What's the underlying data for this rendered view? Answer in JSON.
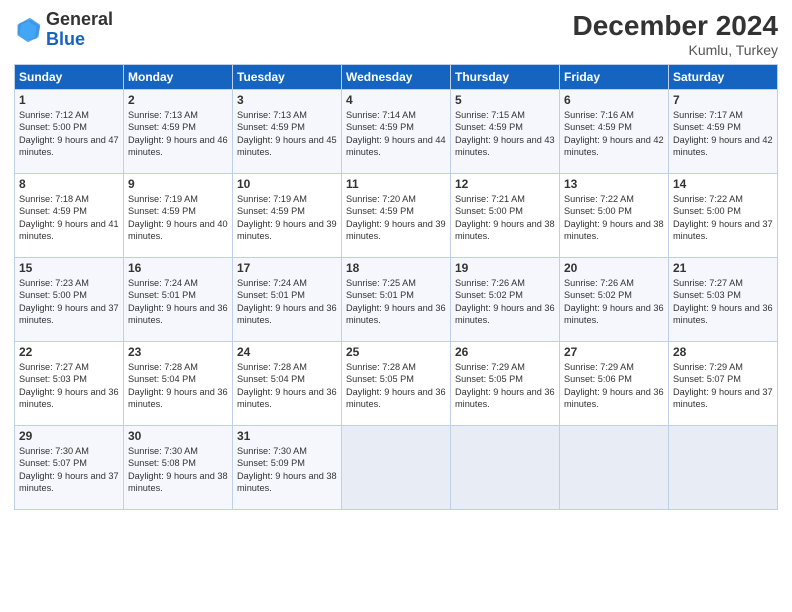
{
  "header": {
    "logo_general": "General",
    "logo_blue": "Blue",
    "month_title": "December 2024",
    "location": "Kumlu, Turkey"
  },
  "days_of_week": [
    "Sunday",
    "Monday",
    "Tuesday",
    "Wednesday",
    "Thursday",
    "Friday",
    "Saturday"
  ],
  "weeks": [
    [
      {
        "day": "1",
        "sunrise": "Sunrise: 7:12 AM",
        "sunset": "Sunset: 5:00 PM",
        "daylight": "Daylight: 9 hours and 47 minutes."
      },
      {
        "day": "2",
        "sunrise": "Sunrise: 7:13 AM",
        "sunset": "Sunset: 4:59 PM",
        "daylight": "Daylight: 9 hours and 46 minutes."
      },
      {
        "day": "3",
        "sunrise": "Sunrise: 7:13 AM",
        "sunset": "Sunset: 4:59 PM",
        "daylight": "Daylight: 9 hours and 45 minutes."
      },
      {
        "day": "4",
        "sunrise": "Sunrise: 7:14 AM",
        "sunset": "Sunset: 4:59 PM",
        "daylight": "Daylight: 9 hours and 44 minutes."
      },
      {
        "day": "5",
        "sunrise": "Sunrise: 7:15 AM",
        "sunset": "Sunset: 4:59 PM",
        "daylight": "Daylight: 9 hours and 43 minutes."
      },
      {
        "day": "6",
        "sunrise": "Sunrise: 7:16 AM",
        "sunset": "Sunset: 4:59 PM",
        "daylight": "Daylight: 9 hours and 42 minutes."
      },
      {
        "day": "7",
        "sunrise": "Sunrise: 7:17 AM",
        "sunset": "Sunset: 4:59 PM",
        "daylight": "Daylight: 9 hours and 42 minutes."
      }
    ],
    [
      {
        "day": "8",
        "sunrise": "Sunrise: 7:18 AM",
        "sunset": "Sunset: 4:59 PM",
        "daylight": "Daylight: 9 hours and 41 minutes."
      },
      {
        "day": "9",
        "sunrise": "Sunrise: 7:19 AM",
        "sunset": "Sunset: 4:59 PM",
        "daylight": "Daylight: 9 hours and 40 minutes."
      },
      {
        "day": "10",
        "sunrise": "Sunrise: 7:19 AM",
        "sunset": "Sunset: 4:59 PM",
        "daylight": "Daylight: 9 hours and 39 minutes."
      },
      {
        "day": "11",
        "sunrise": "Sunrise: 7:20 AM",
        "sunset": "Sunset: 4:59 PM",
        "daylight": "Daylight: 9 hours and 39 minutes."
      },
      {
        "day": "12",
        "sunrise": "Sunrise: 7:21 AM",
        "sunset": "Sunset: 5:00 PM",
        "daylight": "Daylight: 9 hours and 38 minutes."
      },
      {
        "day": "13",
        "sunrise": "Sunrise: 7:22 AM",
        "sunset": "Sunset: 5:00 PM",
        "daylight": "Daylight: 9 hours and 38 minutes."
      },
      {
        "day": "14",
        "sunrise": "Sunrise: 7:22 AM",
        "sunset": "Sunset: 5:00 PM",
        "daylight": "Daylight: 9 hours and 37 minutes."
      }
    ],
    [
      {
        "day": "15",
        "sunrise": "Sunrise: 7:23 AM",
        "sunset": "Sunset: 5:00 PM",
        "daylight": "Daylight: 9 hours and 37 minutes."
      },
      {
        "day": "16",
        "sunrise": "Sunrise: 7:24 AM",
        "sunset": "Sunset: 5:01 PM",
        "daylight": "Daylight: 9 hours and 36 minutes."
      },
      {
        "day": "17",
        "sunrise": "Sunrise: 7:24 AM",
        "sunset": "Sunset: 5:01 PM",
        "daylight": "Daylight: 9 hours and 36 minutes."
      },
      {
        "day": "18",
        "sunrise": "Sunrise: 7:25 AM",
        "sunset": "Sunset: 5:01 PM",
        "daylight": "Daylight: 9 hours and 36 minutes."
      },
      {
        "day": "19",
        "sunrise": "Sunrise: 7:26 AM",
        "sunset": "Sunset: 5:02 PM",
        "daylight": "Daylight: 9 hours and 36 minutes."
      },
      {
        "day": "20",
        "sunrise": "Sunrise: 7:26 AM",
        "sunset": "Sunset: 5:02 PM",
        "daylight": "Daylight: 9 hours and 36 minutes."
      },
      {
        "day": "21",
        "sunrise": "Sunrise: 7:27 AM",
        "sunset": "Sunset: 5:03 PM",
        "daylight": "Daylight: 9 hours and 36 minutes."
      }
    ],
    [
      {
        "day": "22",
        "sunrise": "Sunrise: 7:27 AM",
        "sunset": "Sunset: 5:03 PM",
        "daylight": "Daylight: 9 hours and 36 minutes."
      },
      {
        "day": "23",
        "sunrise": "Sunrise: 7:28 AM",
        "sunset": "Sunset: 5:04 PM",
        "daylight": "Daylight: 9 hours and 36 minutes."
      },
      {
        "day": "24",
        "sunrise": "Sunrise: 7:28 AM",
        "sunset": "Sunset: 5:04 PM",
        "daylight": "Daylight: 9 hours and 36 minutes."
      },
      {
        "day": "25",
        "sunrise": "Sunrise: 7:28 AM",
        "sunset": "Sunset: 5:05 PM",
        "daylight": "Daylight: 9 hours and 36 minutes."
      },
      {
        "day": "26",
        "sunrise": "Sunrise: 7:29 AM",
        "sunset": "Sunset: 5:05 PM",
        "daylight": "Daylight: 9 hours and 36 minutes."
      },
      {
        "day": "27",
        "sunrise": "Sunrise: 7:29 AM",
        "sunset": "Sunset: 5:06 PM",
        "daylight": "Daylight: 9 hours and 36 minutes."
      },
      {
        "day": "28",
        "sunrise": "Sunrise: 7:29 AM",
        "sunset": "Sunset: 5:07 PM",
        "daylight": "Daylight: 9 hours and 37 minutes."
      }
    ],
    [
      {
        "day": "29",
        "sunrise": "Sunrise: 7:30 AM",
        "sunset": "Sunset: 5:07 PM",
        "daylight": "Daylight: 9 hours and 37 minutes."
      },
      {
        "day": "30",
        "sunrise": "Sunrise: 7:30 AM",
        "sunset": "Sunset: 5:08 PM",
        "daylight": "Daylight: 9 hours and 38 minutes."
      },
      {
        "day": "31",
        "sunrise": "Sunrise: 7:30 AM",
        "sunset": "Sunset: 5:09 PM",
        "daylight": "Daylight: 9 hours and 38 minutes."
      },
      null,
      null,
      null,
      null
    ]
  ]
}
